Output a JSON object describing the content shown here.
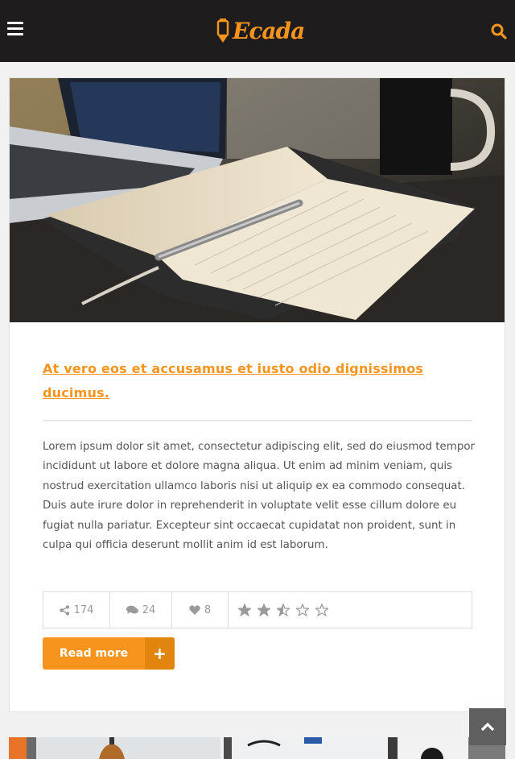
{
  "header": {
    "logo_text": "Ecada",
    "menu_icon": "hamburger-menu-icon",
    "search_icon": "search-icon",
    "accent_color": "#f7941d",
    "bar_color": "#1e1c1c"
  },
  "post": {
    "image_alt": "Open notebook with pen next to a laptop and a mug",
    "title": "At vero eos et accusamus et iusto odio dignissimos ducimus.",
    "excerpt": "Lorem ipsum dolor sit amet, consectetur adipiscing elit, sed do eiusmod tempor incididunt ut labore et dolore magna aliqua. Ut enim ad minim veniam, quis nostrud exercitation ullamco laboris nisi ut aliquip ex ea commodo consequat. Duis aute irure dolor in reprehenderit in voluptate velit esse cillum dolore eu fugiat nulla pariatur. Excepteur sint occaecat cupidatat non proident, sunt in culpa qui officia deserunt mollit anim id est laborum.",
    "shares": "174",
    "comments": "24",
    "likes": "8",
    "rating": 2.5,
    "rating_max": 5,
    "read_more_label": "Read more",
    "read_more_icon": "+"
  },
  "scroll_top_icon": "chevron-up-icon"
}
